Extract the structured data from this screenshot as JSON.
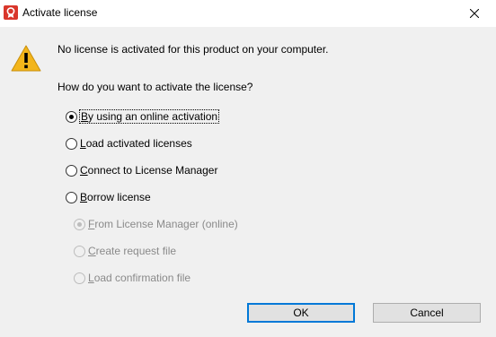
{
  "window": {
    "title": "Activate license",
    "icon": "license-app-icon",
    "close_icon": "close-icon"
  },
  "message": {
    "icon": "warning-icon",
    "text": "No license is activated for this product on your computer.",
    "question": "How do you want to activate the license?"
  },
  "options": [
    {
      "pre": "",
      "key": "B",
      "post": "y using an online activation",
      "checked": true,
      "enabled": true,
      "focused": true
    },
    {
      "pre": "",
      "key": "L",
      "post": "oad activated licenses",
      "checked": false,
      "enabled": true,
      "focused": false
    },
    {
      "pre": "",
      "key": "C",
      "post": "onnect to License Manager",
      "checked": false,
      "enabled": true,
      "focused": false
    },
    {
      "pre": "",
      "key": "B",
      "post": "orrow license",
      "checked": false,
      "enabled": true,
      "focused": false
    }
  ],
  "borrow_options": [
    {
      "pre": "",
      "key": "F",
      "post": "rom License Manager (online)",
      "checked": true,
      "enabled": false
    },
    {
      "pre": "",
      "key": "C",
      "post": "reate request file",
      "checked": false,
      "enabled": false
    },
    {
      "pre": "",
      "key": "L",
      "post": "oad confirmation file",
      "checked": false,
      "enabled": false
    }
  ],
  "buttons": {
    "ok": "OK",
    "cancel": "Cancel"
  },
  "colors": {
    "dialog_bg": "#f0f0f0",
    "titlebar_bg": "#ffffff",
    "default_button_border": "#0078d7",
    "button_bg": "#e1e1e1",
    "disabled_text": "#8a8a8a",
    "warning_yellow": "#f3b51b",
    "app_icon_red": "#d9362b"
  }
}
